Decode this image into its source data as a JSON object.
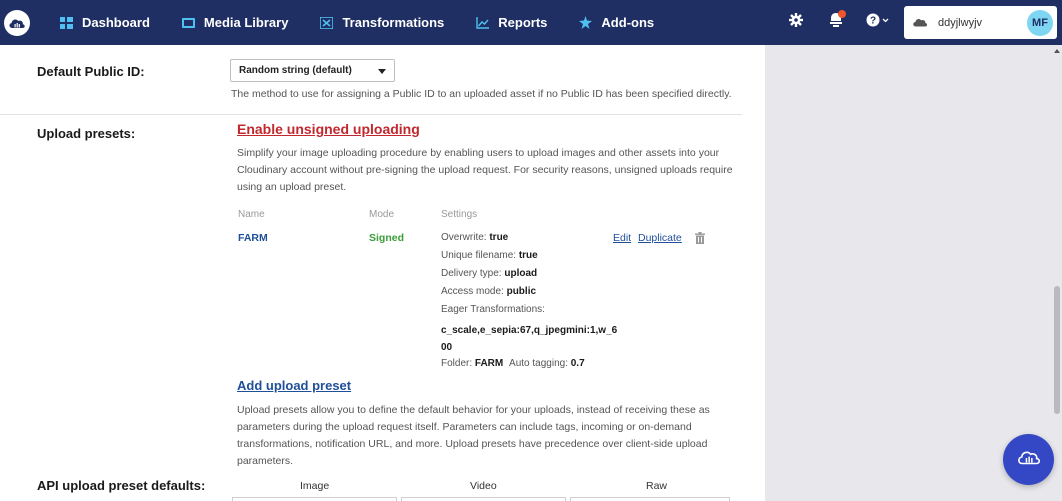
{
  "nav": {
    "items": [
      {
        "label": "Dashboard",
        "icon": "dashboard-icon"
      },
      {
        "label": "Media Library",
        "icon": "media-library-icon"
      },
      {
        "label": "Transformations",
        "icon": "transformations-icon"
      },
      {
        "label": "Reports",
        "icon": "reports-icon"
      },
      {
        "label": "Add-ons",
        "icon": "addons-icon"
      }
    ],
    "account_name": "ddyjlwyjv",
    "avatar_initials": "MF"
  },
  "colors": {
    "topbar": "#1f2f63",
    "accent_blue": "#3448c5",
    "link_red": "#c0282e",
    "link_blue": "#1f4f99",
    "signed_green": "#3a9d3a"
  },
  "settings": {
    "default_public_id": {
      "label": "Default Public ID:",
      "selected": "Random string (default)",
      "help": "The method to use for assigning a Public ID to an uploaded asset if no Public ID has been specified directly."
    },
    "upload_presets": {
      "label": "Upload presets:",
      "enable_link": "Enable unsigned uploading",
      "description_lines": [
        "Simplify your image uploading procedure by enabling users to upload images and other assets into your",
        "Cloudinary account without pre-signing the upload request. For security reasons, unsigned uploads require",
        "using an upload preset."
      ],
      "columns": {
        "name": "Name",
        "mode": "Mode",
        "settings": "Settings"
      },
      "presets": [
        {
          "name": "FARM",
          "mode": "Signed",
          "overwrite_label": "Overwrite:",
          "overwrite": "true",
          "unique_label": "Unique filename:",
          "unique": "true",
          "delivery_label": "Delivery type:",
          "delivery": "upload",
          "access_label": "Access mode:",
          "access": "public",
          "eager_label": "Eager Transformations:",
          "eager": "c_scale,e_sepia:67,q_jpegmini:1,w_600",
          "folder_label": "Folder:",
          "folder": "FARM",
          "tagging_label": "Auto tagging:",
          "tagging": "0.7",
          "edit": "Edit",
          "duplicate": "Duplicate"
        }
      ],
      "add_link": "Add upload preset",
      "add_help_lines": [
        "Upload presets allow you to define the default behavior for your uploads, instead of receiving these as",
        "parameters during the upload request itself. Parameters can include tags, incoming or on-demand",
        "transformations, notification URL, and more. Upload presets have precedence over client-side upload",
        "parameters."
      ]
    },
    "api_defaults": {
      "label": "API upload preset defaults:",
      "columns": [
        "Image",
        "Video",
        "Raw"
      ]
    }
  }
}
